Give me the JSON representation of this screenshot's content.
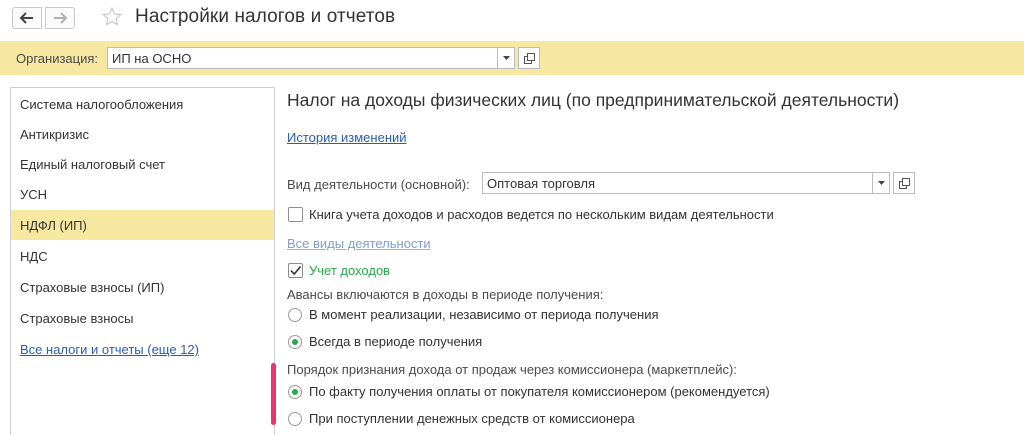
{
  "window": {
    "title": "Настройки налогов и отчетов",
    "back_icon": "arrow-left-icon",
    "forward_icon": "arrow-right-icon",
    "favorite_icon": "star-icon"
  },
  "organization": {
    "label": "Организация:",
    "value": "ИП на ОСНО"
  },
  "sidebar": {
    "items": [
      {
        "label": "Система налогообложения",
        "active": false
      },
      {
        "label": "Антикризис",
        "active": false
      },
      {
        "label": "Единый налоговый счет",
        "active": false
      },
      {
        "label": "УСН",
        "active": false
      },
      {
        "label": "НДФЛ (ИП)",
        "active": true
      },
      {
        "label": "НДС",
        "active": false
      },
      {
        "label": "Страховые взносы (ИП)",
        "active": false
      },
      {
        "label": "Страховые взносы",
        "active": false
      }
    ],
    "all_link": "Все налоги и отчеты (еще 12)"
  },
  "main": {
    "title": "Налог на доходы физических лиц (по предпринимательской деятельности)",
    "history_link": "История изменений",
    "activity_label": "Вид деятельности (основной):",
    "activity_value": "Оптовая торговля",
    "multi_activity_checkbox": {
      "label": "Книга учета доходов и расходов ведется по нескольким видам деятельности",
      "checked": false
    },
    "all_activities_link": "Все виды деятельности",
    "income_checkbox": {
      "label": "Учет доходов",
      "checked": true
    },
    "advances_label": "Авансы включаются в доходы в периоде получения:",
    "advances_options": [
      {
        "label": "В момент реализации, независимо от периода получения",
        "selected": false
      },
      {
        "label": "Всегда в периоде получения",
        "selected": true
      }
    ],
    "commission_label": "Порядок признания дохода от продаж через комиссионера (маркетплейс):",
    "commission_options": [
      {
        "label": "По факту получения оплаты от покупателя комиссионером (рекомендуется)",
        "selected": true
      },
      {
        "label": "При поступлении денежных средств от комиссионера",
        "selected": false
      }
    ]
  },
  "colors": {
    "accent_yellow": "#f6e7a1",
    "link_blue": "#2a5ea8",
    "check_green": "#2aa84a",
    "marker_pink": "#e8386b"
  }
}
